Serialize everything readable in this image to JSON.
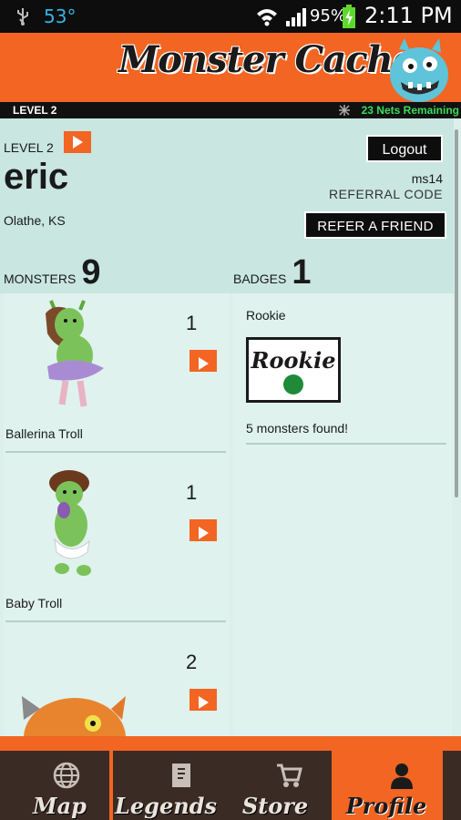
{
  "status_bar": {
    "temperature": "53°",
    "battery_percent": "95%",
    "time": "2:11 PM",
    "icons": [
      "usb-icon",
      "wifi-icon",
      "signal-icon",
      "battery-charging-icon"
    ]
  },
  "header": {
    "logo_text": "Monster Cache",
    "mascot": "blue-monster-mascot"
  },
  "level_bar": {
    "level": "LEVEL 2",
    "nets_remaining": "23 Nets Remaining"
  },
  "profile": {
    "level": "LEVEL 2",
    "username": "eric",
    "location": "Olathe, KS",
    "logout_label": "Logout",
    "referral_code": "ms14",
    "referral_code_label": "REFERRAL CODE",
    "refer_label": "REFER A FRIEND",
    "monsters_label": "MONSTERS",
    "monsters_count": "9",
    "badges_label": "BADGES",
    "badges_count": "1"
  },
  "monsters": [
    {
      "name": "Ballerina Troll",
      "count": "1"
    },
    {
      "name": "Baby Troll",
      "count": "1"
    },
    {
      "name": "",
      "count": "2"
    }
  ],
  "badges": [
    {
      "name": "Rookie",
      "image_text": "Rookie",
      "description": "5 monsters found!"
    }
  ],
  "tabs": [
    {
      "label": "Map",
      "icon": "globe-icon",
      "active": false
    },
    {
      "label": "Legends",
      "icon": "book-icon",
      "active": false
    },
    {
      "label": "Store",
      "icon": "cart-icon",
      "active": false
    },
    {
      "label": "Profile",
      "icon": "person-icon",
      "active": true
    }
  ],
  "colors": {
    "accent_orange": "#f26522",
    "background_mint": "#dcefea",
    "nets_green": "#3cdc5a",
    "tab_dark": "#3a2b25"
  }
}
